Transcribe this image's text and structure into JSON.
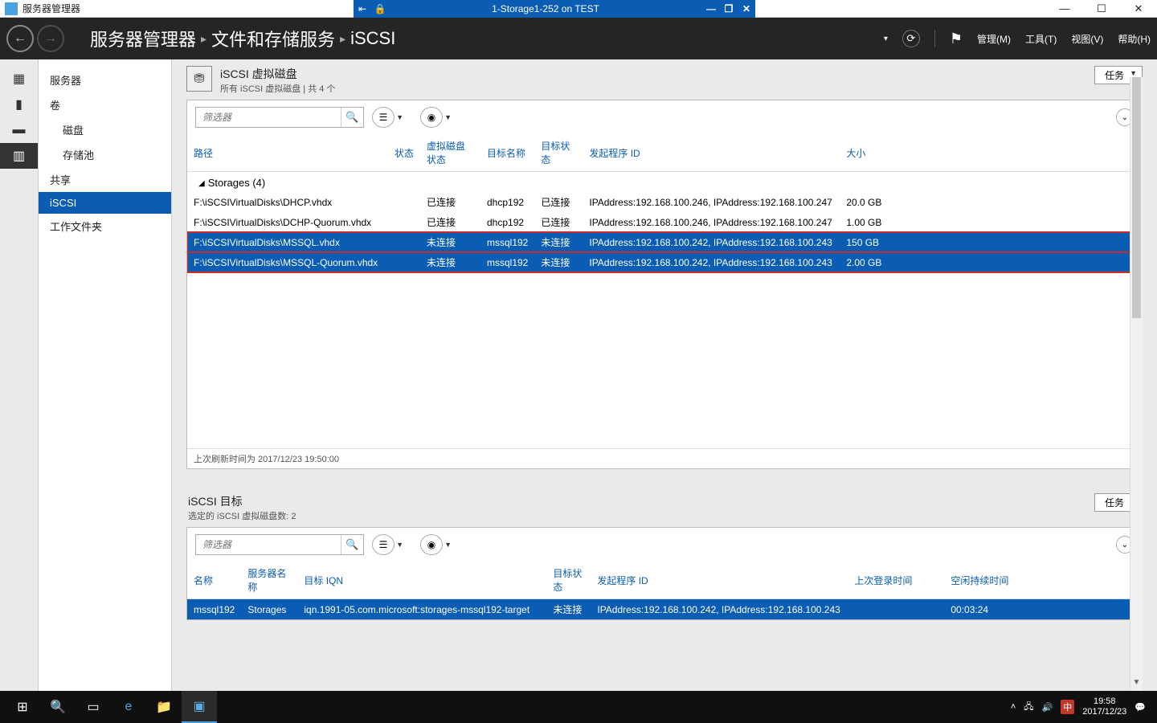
{
  "outer": {
    "title": "服务器管理器"
  },
  "remote": {
    "title": "1-Storage1-252 on TEST"
  },
  "header": {
    "bc1": "服务器管理器",
    "bc2": "文件和存储服务",
    "bc3": "iSCSI",
    "menu_manage": "管理(M)",
    "menu_tools": "工具(T)",
    "menu_view": "视图(V)",
    "menu_help": "帮助(H)"
  },
  "nav": {
    "servers": "服务器",
    "volumes": "卷",
    "disks": "磁盘",
    "pools": "存储池",
    "shares": "共享",
    "iscsi": "iSCSI",
    "workfolders": "工作文件夹"
  },
  "vdisk": {
    "title": "iSCSI 虚拟磁盘",
    "subtitle": "所有 iSCSI 虚拟磁盘 | 共 4 个",
    "tasks": "任务",
    "filter_ph": "筛选器",
    "cols": {
      "path": "路径",
      "status": "状态",
      "vstatus": "虚拟磁盘状态",
      "tname": "目标名称",
      "tstatus": "目标状态",
      "initiator": "发起程序 ID",
      "size": "大小"
    },
    "group": "Storages (4)",
    "rows": [
      {
        "path": "F:\\iSCSIVirtualDisks\\DHCP.vhdx",
        "status": "",
        "vstatus": "已连接",
        "tname": "dhcp192",
        "tstatus": "已连接",
        "init": "IPAddress:192.168.100.246, IPAddress:192.168.100.247",
        "size": "20.0 GB"
      },
      {
        "path": "F:\\iSCSIVirtualDisks\\DCHP-Quorum.vhdx",
        "status": "",
        "vstatus": "已连接",
        "tname": "dhcp192",
        "tstatus": "已连接",
        "init": "IPAddress:192.168.100.246, IPAddress:192.168.100.247",
        "size": "1.00 GB"
      },
      {
        "path": "F:\\iSCSIVirtualDisks\\MSSQL.vhdx",
        "status": "",
        "vstatus": "未连接",
        "tname": "mssql192",
        "tstatus": "未连接",
        "init": "IPAddress:192.168.100.242, IPAddress:192.168.100.243",
        "size": "150 GB"
      },
      {
        "path": "F:\\iSCSIVirtualDisks\\MSSQL-Quorum.vhdx",
        "status": "",
        "vstatus": "未连接",
        "tname": "mssql192",
        "tstatus": "未连接",
        "init": "IPAddress:192.168.100.242, IPAddress:192.168.100.243",
        "size": "2.00 GB"
      }
    ],
    "footer": "上次刷新时间为 2017/12/23 19:50:00"
  },
  "target": {
    "title": "iSCSI 目标",
    "subtitle": "选定的 iSCSI 虚拟磁盘数: 2",
    "tasks": "任务",
    "filter_ph": "筛选器",
    "cols": {
      "name": "名称",
      "server": "服务器名称",
      "iqn": "目标 IQN",
      "tstatus": "目标状态",
      "init": "发起程序 ID",
      "lastlogin": "上次登录时间",
      "idle": "空闲持续时间"
    },
    "row": {
      "name": "mssql192",
      "server": "Storages",
      "iqn": "iqn.1991-05.com.microsoft:storages-mssql192-target",
      "tstatus": "未连接",
      "init": "IPAddress:192.168.100.242, IPAddress:192.168.100.243",
      "lastlogin": "",
      "idle": "00:03:24"
    }
  },
  "tray": {
    "time": "19:58",
    "date": "2017/12/23",
    "ime": "中"
  }
}
